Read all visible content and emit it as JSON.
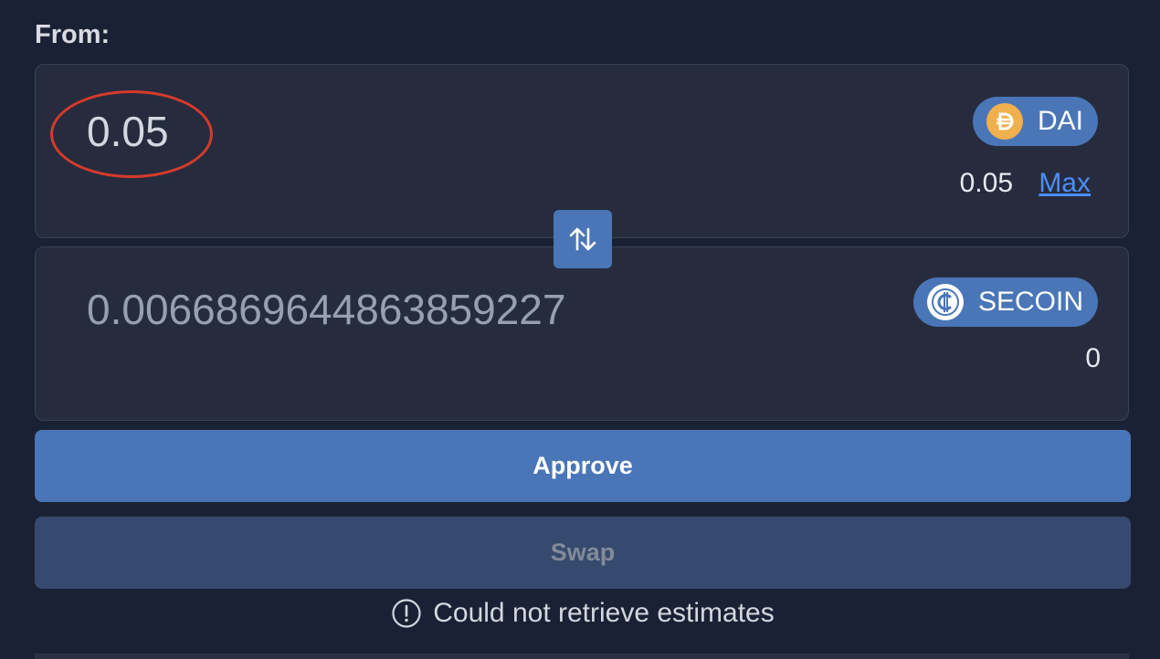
{
  "from_section": {
    "label": "From:",
    "amount_value": "0.05",
    "token": {
      "symbol": "DAI",
      "icon": "dai-icon",
      "color": "#f0b04d"
    },
    "balance": "0.05",
    "max_label": "Max"
  },
  "to_section": {
    "amount_value": "0.0066869644863859227",
    "token": {
      "symbol": "SECOIN",
      "icon": "secoin-icon"
    },
    "balance": "0"
  },
  "swap_direction_icon": "arrows-up-down-icon",
  "buttons": {
    "approve_label": "Approve",
    "swap_label": "Swap"
  },
  "status": {
    "icon": "info-circle-icon",
    "message": "Could not retrieve estimates"
  },
  "colors": {
    "background": "#1b2134",
    "panel": "#262c3e",
    "accent": "#4a76b8",
    "link": "#4c8ef7",
    "annotation": "#d63a2a"
  }
}
